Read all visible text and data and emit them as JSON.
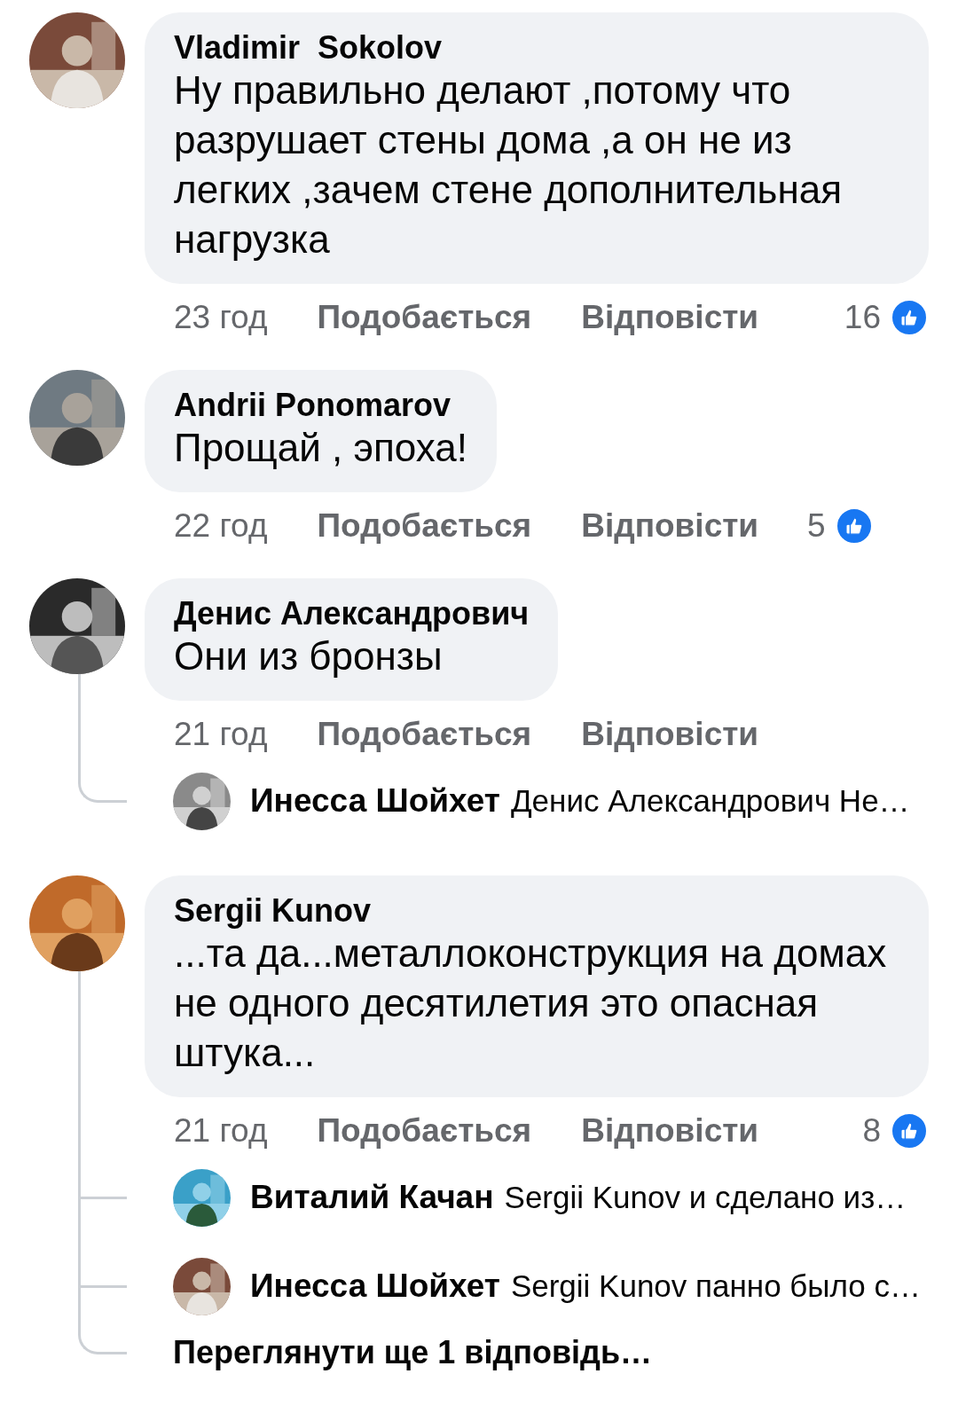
{
  "comments": [
    {
      "author": "Vladimir  Sokolov",
      "text": "Ну правильно делают ,потому что разрушает стены дома ,а он не из легких ,зачем стене дополнительная нагрузка",
      "time": "23 год",
      "like_label": "Подобається",
      "reply_label": "Відповісти",
      "reactions": "16"
    },
    {
      "author": "Andrii Ponomarov",
      "text": "Прощай , эпоха!",
      "time": "22 год",
      "like_label": "Подобається",
      "reply_label": "Відповісти",
      "reactions": "5"
    },
    {
      "author": "Денис Александрович",
      "text": "Они из бронзы",
      "time": "21 год",
      "like_label": "Подобається",
      "reply_label": "Відповісти",
      "replies": [
        {
          "author": "Инесса Шойхет",
          "text": "Денис Александрович Не…"
        }
      ]
    },
    {
      "author": "Sergii Kunov",
      "text": "...та да...металлоконструкция на домах не одного десятилетия это опасная штука...",
      "time": "21 год",
      "like_label": "Подобається",
      "reply_label": "Відповісти",
      "reactions": "8",
      "replies": [
        {
          "author": "Виталий Качан",
          "text": "Sergii Kunov и сделано из…"
        },
        {
          "author": "Инесса Шойхет",
          "text": "Sergii Kunov панно было с…"
        }
      ],
      "more_replies": "Переглянути ще 1 відповідь…"
    }
  ]
}
